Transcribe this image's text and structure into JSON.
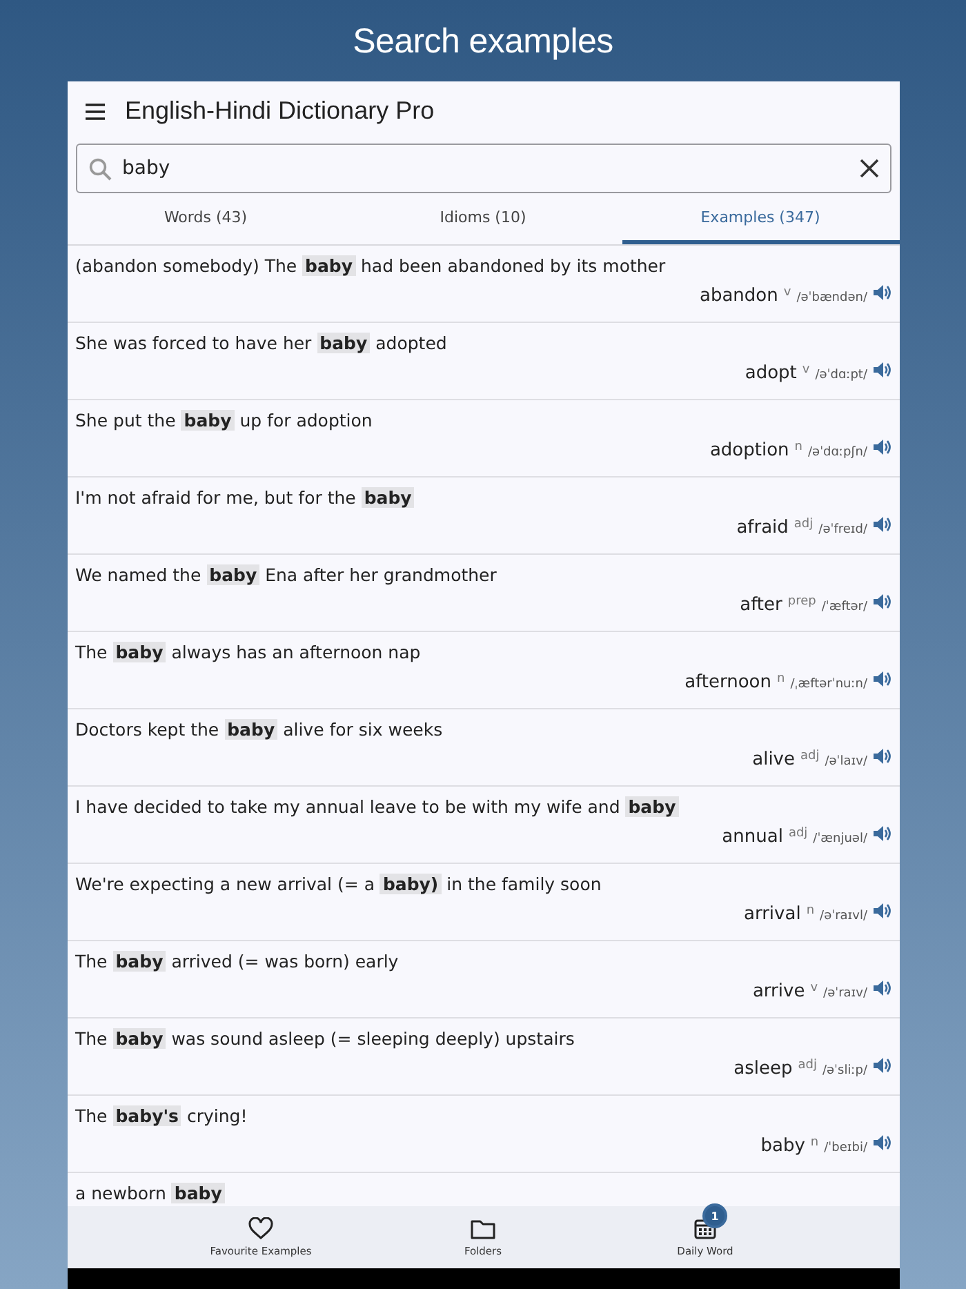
{
  "page_title": "Search examples",
  "app_bar": {
    "title": "English-Hindi Dictionary Pro"
  },
  "search": {
    "value": "baby"
  },
  "tabs": [
    {
      "label": "Words (43)",
      "selected": false
    },
    {
      "label": "Idioms (10)",
      "selected": false
    },
    {
      "label": "Examples (347)",
      "selected": true
    }
  ],
  "examples": [
    {
      "sentence": "(abandon somebody) The **baby** had been abandoned by its mother",
      "word": "abandon",
      "pos": "v",
      "pronunciation": "/əˈbændən/"
    },
    {
      "sentence": "She was forced to have her **baby** adopted",
      "word": "adopt",
      "pos": "v",
      "pronunciation": "/əˈdɑːpt/"
    },
    {
      "sentence": "She put the **baby** up for adoption",
      "word": "adoption",
      "pos": "n",
      "pronunciation": "/əˈdɑːpʃn/"
    },
    {
      "sentence": "I'm not afraid for me, but for the **baby**",
      "word": "afraid",
      "pos": "adj",
      "pronunciation": "/əˈfreɪd/"
    },
    {
      "sentence": "We named the **baby** Ena after her grandmother",
      "word": "after",
      "pos": "prep",
      "pronunciation": "/ˈæftər/"
    },
    {
      "sentence": "The **baby** always has an afternoon nap",
      "word": "afternoon",
      "pos": "n",
      "pronunciation": "/ˌæftərˈnuːn/"
    },
    {
      "sentence": "Doctors kept the **baby** alive for six weeks",
      "word": "alive",
      "pos": "adj",
      "pronunciation": "/əˈlaɪv/"
    },
    {
      "sentence": "I have decided to take my annual leave to be with my wife and **baby**",
      "word": "annual",
      "pos": "adj",
      "pronunciation": "/ˈænjuəl/"
    },
    {
      "sentence": "We're expecting a new arrival (= a **baby)** in the family soon",
      "word": "arrival",
      "pos": "n",
      "pronunciation": "/əˈraɪvl/"
    },
    {
      "sentence": "The **baby** arrived (= was born) early",
      "word": "arrive",
      "pos": "v",
      "pronunciation": "/əˈraɪv/"
    },
    {
      "sentence": "The **baby** was sound asleep (= sleeping deeply) upstairs",
      "word": "asleep",
      "pos": "adj",
      "pronunciation": "/əˈsliːp/"
    },
    {
      "sentence": "The **baby's** crying!",
      "word": "baby",
      "pos": "n",
      "pronunciation": "/ˈbeɪbi/"
    },
    {
      "sentence": "a newborn **baby**"
    }
  ],
  "bottom_nav": [
    {
      "kind": "heart",
      "label": "Favourite Examples"
    },
    {
      "kind": "folder",
      "label": "Folders"
    },
    {
      "kind": "calendar",
      "label": "Daily Word",
      "badge": "1"
    }
  ]
}
